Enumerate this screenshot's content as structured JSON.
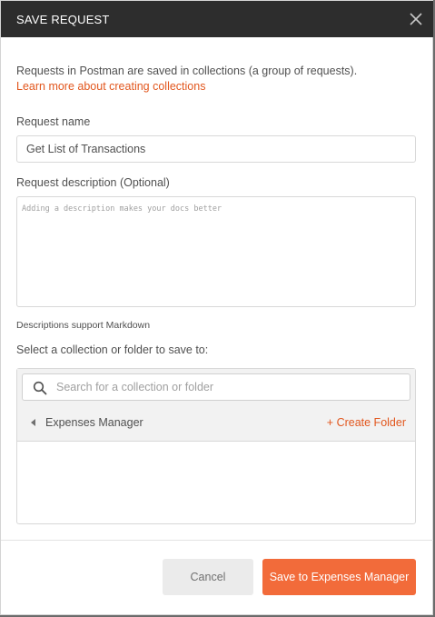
{
  "dialog": {
    "title": "SAVE REQUEST",
    "close_icon": "close-icon"
  },
  "intro": {
    "text": "Requests in Postman are saved in collections (a group of requests).",
    "link": "Learn more about creating collections"
  },
  "request_name": {
    "label": "Request name",
    "value": "Get List of Transactions"
  },
  "request_description": {
    "label": "Request description (Optional)",
    "placeholder": "Adding a description makes your docs better",
    "hint": "Descriptions support Markdown"
  },
  "collection_select": {
    "label": "Select a collection or folder to save to:",
    "search_placeholder": "Search for a collection or folder",
    "search_icon": "search-icon",
    "current_collection": "Expenses Manager",
    "create_folder": "+ Create Folder"
  },
  "footer": {
    "cancel_label": "Cancel",
    "save_label": "Save to Expenses Manager"
  },
  "colors": {
    "accent": "#e2571e",
    "primary_button": "#f26b3a",
    "titlebar": "#2d2d2d"
  }
}
